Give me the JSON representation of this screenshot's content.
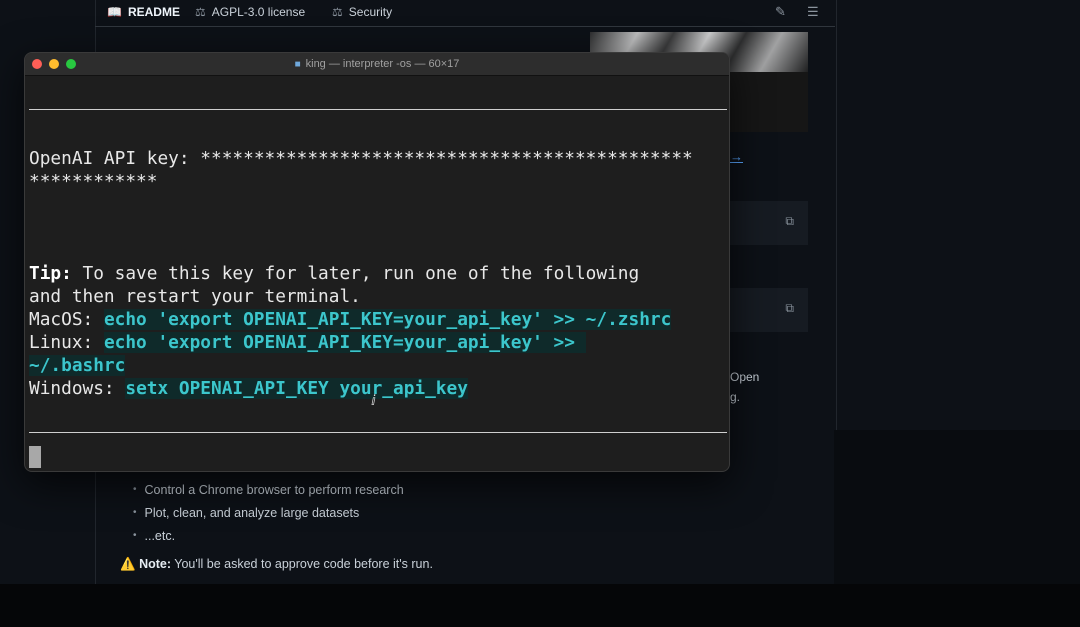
{
  "github": {
    "tabs": [
      {
        "label": "README",
        "icon": "book-icon"
      },
      {
        "label": "AGPL-3.0 license",
        "icon": "scale-icon"
      },
      {
        "label": "Security",
        "icon": "scale-icon"
      }
    ],
    "side_link": "→",
    "side_text_1": "Open",
    "side_text_2": "g.",
    "list_items": [
      "Control a Chrome browser to perform research",
      "Plot, clean, and analyze large datasets",
      "...etc."
    ],
    "note_icon": "⚠️",
    "note_bold": "Note:",
    "note_text": " You'll be asked to approve code before it's run."
  },
  "terminal": {
    "title": "king — interpreter -os — 60×17",
    "api_key_label": "OpenAI API key: ",
    "api_key_mask_1": "**********************************************",
    "api_key_mask_2": "************",
    "tip_label": "Tip:",
    "tip_text_1": " To save this key for later, run one of the following",
    "tip_text_2": "and then restart your terminal.",
    "macos_label": "MacOS: ",
    "macos_cmd": "echo 'export OPENAI_API_KEY=your_api_key' >> ~/.zshrc",
    "linux_label": "Linux: ",
    "linux_cmd_1": "echo 'export OPENAI_API_KEY=your_api_key' >> ",
    "linux_cmd_2": "~/.bashrc",
    "windows_label": "Windows: ",
    "windows_cmd": "setx OPENAI_API_KEY your_api_key"
  }
}
